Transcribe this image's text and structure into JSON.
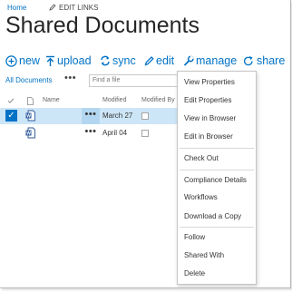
{
  "topbar": {
    "home": "Home",
    "edit_links": "EDIT LINKS"
  },
  "page_title": "Shared Documents",
  "toolbar": {
    "new": "new",
    "upload": "upload",
    "sync": "sync",
    "edit": "edit",
    "manage": "manage",
    "share": "share"
  },
  "viewbar": {
    "all_documents": "All Documents",
    "more": "•••",
    "find_placeholder": "Find a file"
  },
  "columns": {
    "name": "Name",
    "modified": "Modified",
    "modified_by": "Modified By"
  },
  "rows": [
    {
      "modified": "March 27",
      "selected": true,
      "menu": "•••"
    },
    {
      "modified": "April 04",
      "selected": false,
      "menu": "•••"
    }
  ],
  "context_menu": {
    "items": [
      "View Properties",
      "Edit Properties",
      "View in Browser",
      "Edit in Browser",
      "Check Out",
      "Compliance Details",
      "Workflows",
      "Download a Copy",
      "Follow",
      "Shared With",
      "Delete"
    ]
  },
  "colors": {
    "accent": "#0072c6",
    "selected_row": "#cde6f7",
    "word_icon": "#2b579a"
  }
}
